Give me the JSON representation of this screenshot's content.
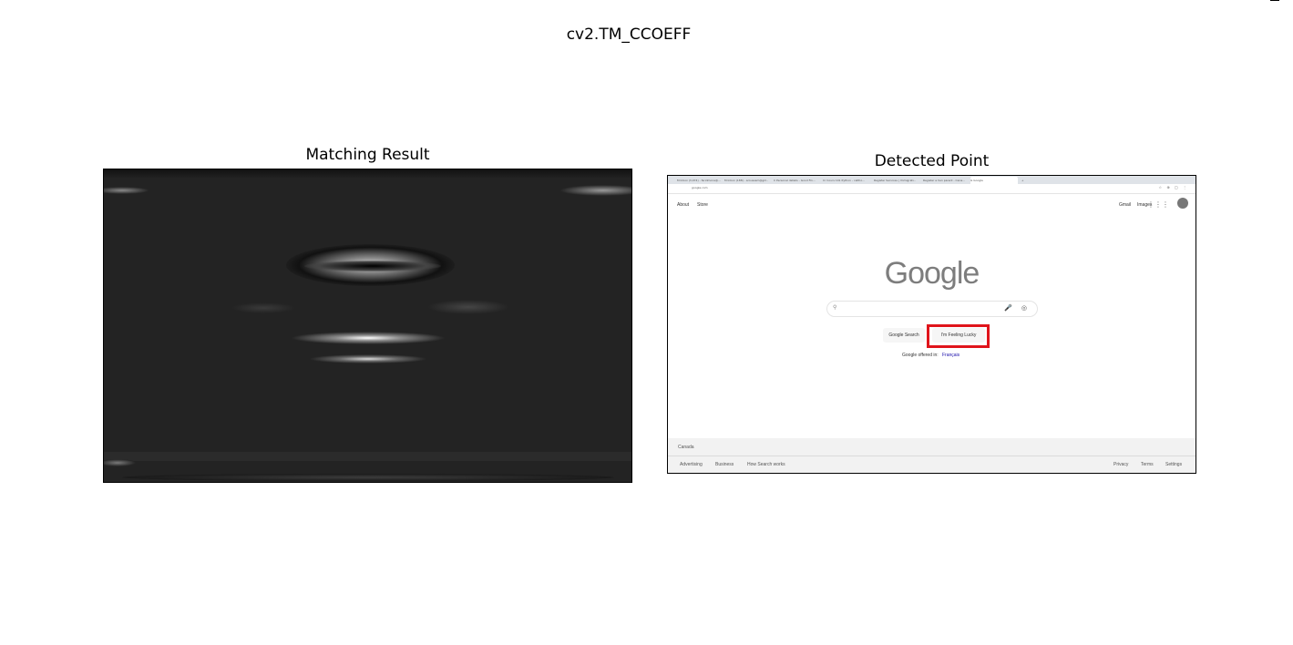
{
  "figure": {
    "suptitle": "cv2.TM_CCOEFF"
  },
  "left_axis": {
    "title": "Matching Result"
  },
  "right_axis": {
    "title": "Detected Point"
  },
  "browser": {
    "tabs": [
      "M Inbox (3,074) - faridmona@...",
      "M Inbox (188) - aroussam@gm...",
      "C Personal details - Good Fin...",
      "Cr Cours 101 Python - caltho...",
      "Register Services | Immigrati...",
      "Register a hen parent - Cana...",
      "G Google"
    ],
    "new_tab": "+",
    "url": "google.com",
    "toolbar_icons": "☆ ⊕ ▢ ⋮"
  },
  "google": {
    "nav_left": [
      "About",
      "Store"
    ],
    "nav_right": [
      "Gmail",
      "Images"
    ],
    "apps_icon": "⋮⋮⋮",
    "logo": "Google",
    "search_button": "Google Search",
    "lucky_button": "I'm Feeling Lucky",
    "offered_label": "Google offered in:",
    "offered_language": "Français",
    "footer_country": "Canada",
    "footer_left": [
      "Advertising",
      "Business",
      "How Search works"
    ],
    "footer_right": [
      "Privacy",
      "Terms",
      "Settings"
    ],
    "search_glyph": "⚲",
    "mic_glyph": "🎤",
    "lens_glyph": "◎"
  },
  "detection": {
    "box_color": "#e0141b",
    "target": "I'm Feeling Lucky"
  }
}
